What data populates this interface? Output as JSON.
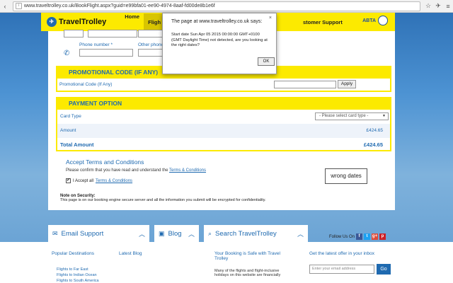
{
  "browser": {
    "url": "www.traveltrolley.co.uk/BookFlight.aspx?guid=e99bfa01-ee90-4974-8aaf-fd00de8b1e6f"
  },
  "header": {
    "logo_text": "TravelTrolley",
    "menu": [
      "Home",
      "Fligh"
    ],
    "menu_right": "stomer Support",
    "abta_label": "ABTA"
  },
  "contact": {
    "phone_label": "Phone number *",
    "other_phone_label": "Other phone"
  },
  "promo": {
    "section_title": "PROMOTIONAL CODE (IF ANY)",
    "label": "Promotional Code (If Any)",
    "input_value": "",
    "apply_label": "Apply"
  },
  "payment": {
    "section_title": "PAYMENT OPTION",
    "card_type_label": "Card Type",
    "card_type_placeholder": "- Please select card type -",
    "amount_label": "Amount",
    "amount_value": "£424.65",
    "total_label": "Total Amount",
    "total_value": "£424.65"
  },
  "terms": {
    "title": "Accept Terms and Conditions",
    "confirm_text": "Please confirm that you have read and understand the",
    "terms_link": "Terms & Conditions",
    "accept_text": "I Accept all",
    "accept_link": "Terms & Conditions",
    "checkbox_mark": "✔"
  },
  "security": {
    "title": "Note on Security:",
    "text": "This page is on our booking engine secure server and all the information you submit will be encrypted for confidentiality."
  },
  "annotation": {
    "text": "wrong dates"
  },
  "footer": {
    "email_support": "Email Support",
    "blog": "Blog",
    "search": "Search TravelTrolley",
    "follow_us": "Follow Us On",
    "popular_destinations": "Popular Destinations",
    "latest_blog": "Latest Blog",
    "safe_title": "Your Booking is Safe with Travel Trolley",
    "safe_text": "Many of the flights and flight-inclusive holidays on this website are financially",
    "latest_offer": "Get the latest offer in your inbox",
    "email_placeholder": "Enter your email address",
    "go_label": "Go",
    "links": [
      "Flights to Far East",
      "Flights to Indian Ocean",
      "Flights to South America"
    ],
    "social": [
      "f",
      "t",
      "g+",
      "p"
    ]
  },
  "dialog": {
    "title": "The page at www.traveltrolley.co.uk says:",
    "message": "Start date Sun Apr 05 2015 00:00:00 GMT+0100 (GMT Daylight Time) not detected, are you looking at the right dates?",
    "ok_label": "OK",
    "close_glyph": "×"
  },
  "colors": {
    "yellow": "#fcea00",
    "blue": "#1f6ab0"
  }
}
